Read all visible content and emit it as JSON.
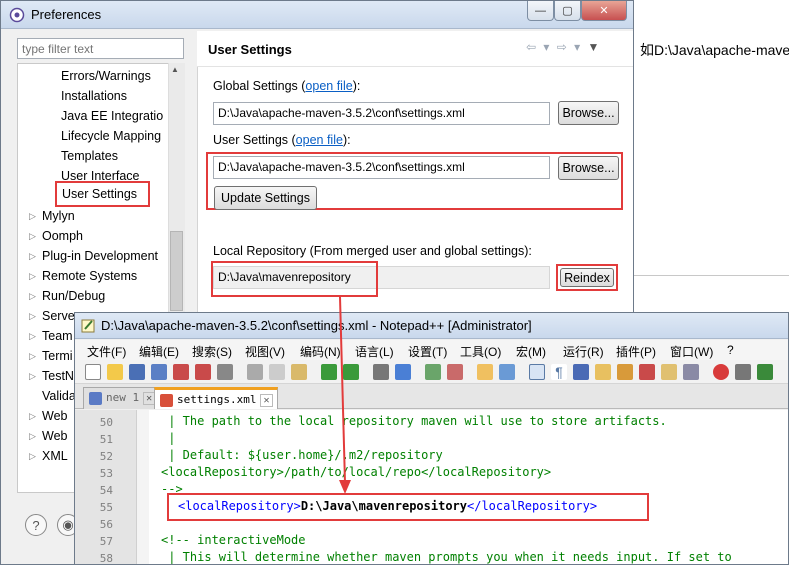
{
  "background": {
    "visible_text": "如D:\\Java\\apache-mave"
  },
  "preferences": {
    "title": "Preferences",
    "filter_placeholder": "type filter text",
    "tree_items": [
      {
        "label": "Errors/Warnings"
      },
      {
        "label": "Installations"
      },
      {
        "label": "Java EE Integratio"
      },
      {
        "label": "Lifecycle Mapping"
      },
      {
        "label": "Templates"
      },
      {
        "label": "User Interface"
      },
      {
        "label": "User Settings"
      },
      {
        "label": "Mylyn"
      },
      {
        "label": "Oomph"
      },
      {
        "label": "Plug-in Development"
      },
      {
        "label": "Remote Systems"
      },
      {
        "label": "Run/Debug"
      },
      {
        "label": "Serve"
      },
      {
        "label": "Team"
      },
      {
        "label": "Termi"
      },
      {
        "label": "TestN"
      },
      {
        "label": "Valida"
      },
      {
        "label": "Web"
      },
      {
        "label": "Web"
      },
      {
        "label": "XML"
      }
    ],
    "panel": {
      "title": "User Settings",
      "global_label": "Global Settings (",
      "global_link": "open file",
      "global_suffix": "):",
      "global_path": "D:\\Java\\apache-maven-3.5.2\\conf\\settings.xml",
      "browse_label": "Browse...",
      "user_label": "User Settings (",
      "user_link": "open file",
      "user_suffix": "):",
      "user_path": "D:\\Java\\apache-maven-3.5.2\\conf\\settings.xml",
      "update_label": "Update Settings",
      "local_repo_label": "Local Repository (From merged user and global settings):",
      "local_repo_path": "D:\\Java\\mavenrepository",
      "reindex_label": "Reindex"
    }
  },
  "notepad": {
    "title": "D:\\Java\\apache-maven-3.5.2\\conf\\settings.xml - Notepad++ [Administrator]",
    "menu": [
      "文件(F)",
      "编辑(E)",
      "搜索(S)",
      "视图(V)",
      "编码(N)",
      "语言(L)",
      "设置(T)",
      "工具(O)",
      "宏(M)",
      "运行(R)",
      "插件(P)",
      "窗口(W)",
      "?"
    ],
    "tabs": [
      {
        "label": "new 1"
      },
      {
        "label": "settings.xml"
      }
    ],
    "lines": [
      {
        "num": "50",
        "text": " | The path to the local repository maven will use to store artifacts."
      },
      {
        "num": "51",
        "text": " |"
      },
      {
        "num": "52",
        "text": " | Default: ${user.home}/.m2/repository"
      },
      {
        "num": "53",
        "text": "<localRepository>/path/to/local/repo</localRepository>"
      },
      {
        "num": "54",
        "text": "-->"
      },
      {
        "num": "55",
        "open_tag": "<localRepository>",
        "value": "D:\\Java\\mavenrepository",
        "close_tag": "</localRepository>"
      },
      {
        "num": "56",
        "text": ""
      },
      {
        "num": "57",
        "text": "<!-- interactiveMode"
      },
      {
        "num": "58",
        "text": " | This will determine whether maven prompts you when it needs input. If set to"
      }
    ]
  },
  "colors": {
    "highlight": "#e23b3b",
    "link": "#0a5fc5",
    "comment": "#008000",
    "tag": "#0000ff"
  }
}
